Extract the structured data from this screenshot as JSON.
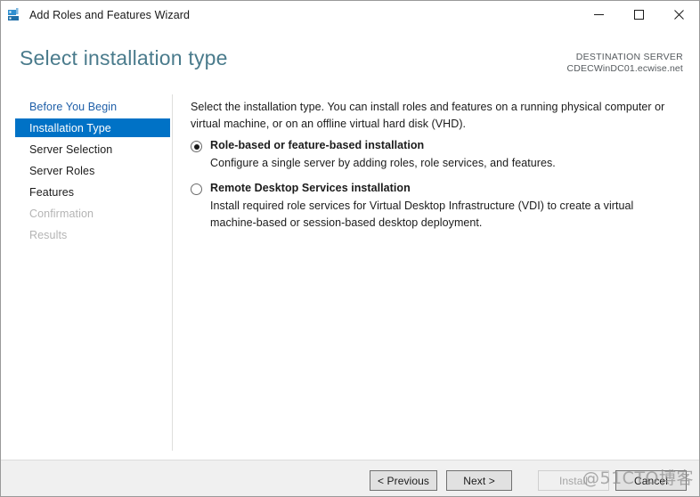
{
  "window": {
    "title": "Add Roles and Features Wizard",
    "icon": "wizard-icon",
    "controls": {
      "minimize": "minimize-icon",
      "maximize": "maximize-icon",
      "close": "close-icon"
    }
  },
  "header": {
    "page_title": "Select installation type",
    "destination_label": "DESTINATION SERVER",
    "destination_server": "CDECWinDC01.ecwise.net"
  },
  "navigation": {
    "items": [
      {
        "label": "Before You Begin",
        "state": "link"
      },
      {
        "label": "Installation Type",
        "state": "selected"
      },
      {
        "label": "Server Selection",
        "state": "normal"
      },
      {
        "label": "Server Roles",
        "state": "normal"
      },
      {
        "label": "Features",
        "state": "normal"
      },
      {
        "label": "Confirmation",
        "state": "disabled"
      },
      {
        "label": "Results",
        "state": "disabled"
      }
    ]
  },
  "content": {
    "intro": "Select the installation type. You can install roles and features on a running physical computer or virtual machine, or on an offline virtual hard disk (VHD).",
    "options": [
      {
        "label": "Role-based or feature-based installation",
        "description": "Configure a single server by adding roles, role services, and features.",
        "selected": true
      },
      {
        "label": "Remote Desktop Services installation",
        "description": "Install required role services for Virtual Desktop Infrastructure (VDI) to create a virtual machine-based or session-based desktop deployment.",
        "selected": false
      }
    ]
  },
  "footer": {
    "previous_label": "< Previous",
    "next_label": "Next >",
    "install_label": "Install",
    "cancel_label": "Cancel"
  },
  "watermark": {
    "text": "@51CTO博客"
  },
  "colors": {
    "accent_blue": "#0072c6",
    "title_teal": "#4a7b8c",
    "link_blue": "#1f5fa8",
    "footer_bg": "#f0f0f0"
  }
}
